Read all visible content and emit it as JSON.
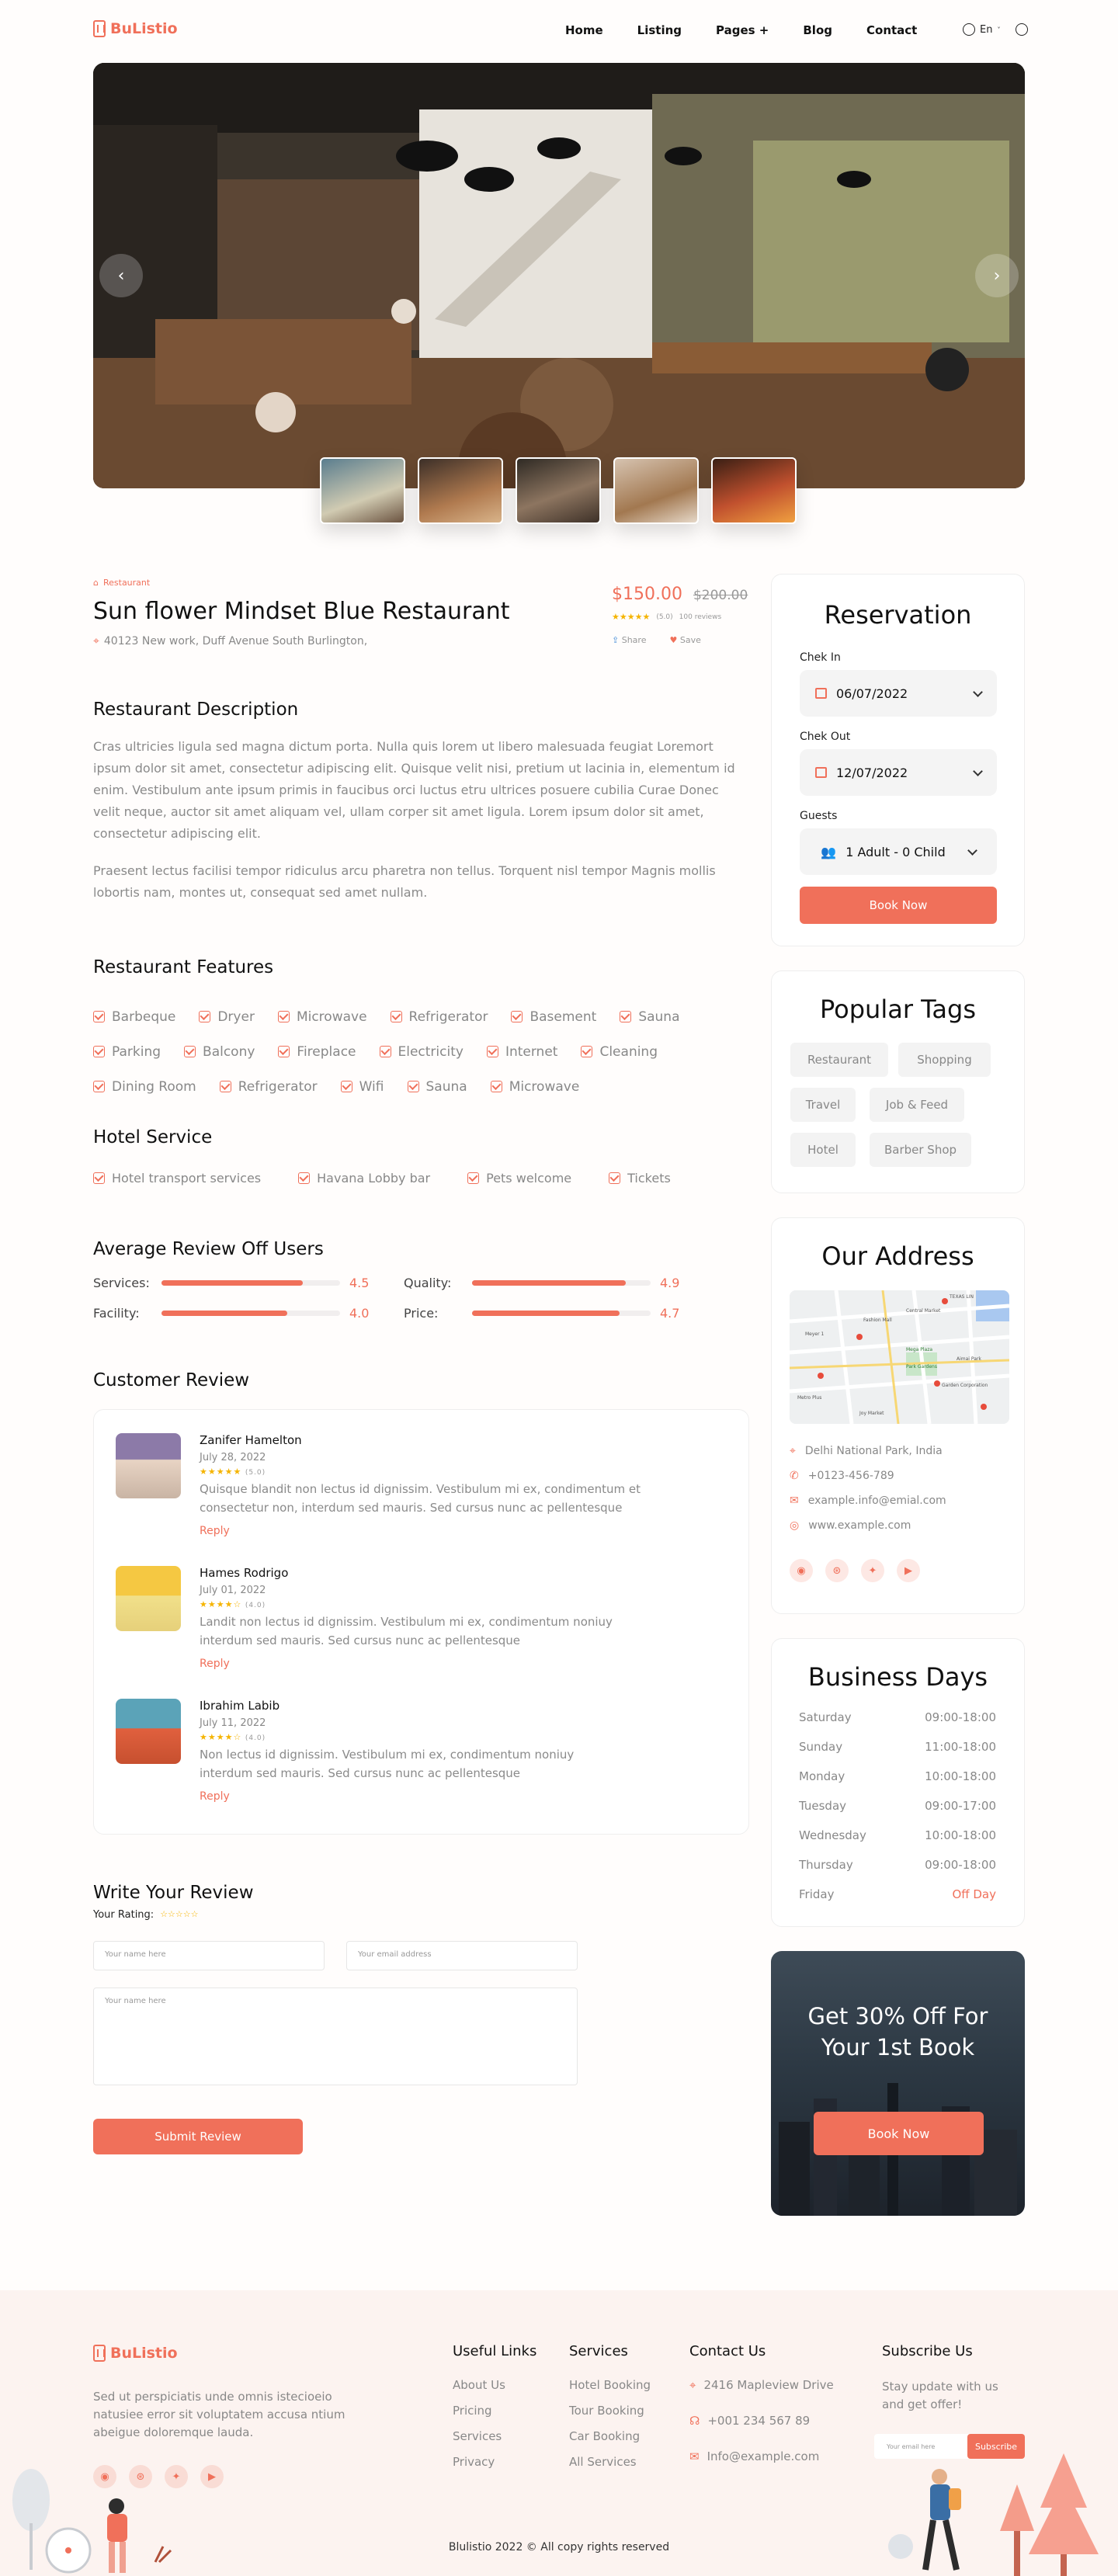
{
  "header": {
    "logo": "BuListio",
    "nav": [
      "Home",
      "Listing",
      "Pages +",
      "Blog",
      "Contact"
    ],
    "lang": "En"
  },
  "hero": {
    "prev_icon": "chevron-left-icon",
    "next_icon": "chevron-right-icon"
  },
  "listing": {
    "category": "Restaurant",
    "title": "Sun flower Mindset Blue Restaurant",
    "address": "40123 New work,  Duff Avenue South Burlington,",
    "price": "$150.00",
    "old_price": "$200.00",
    "rating": "(5.0)",
    "reviews": "100 reviews",
    "share": "Share",
    "save": "Save"
  },
  "description": {
    "title": "Restaurant Description",
    "p1": "Cras ultricies ligula sed magna dictum porta. Nulla quis lorem ut libero malesuada feugiat Loremort ipsum dolor sit amet, consectetur adipiscing elit. Quisque velit nisi, pretium ut lacinia in, elementum id enim. Vestibulum ante ipsum primis in faucibus orci luctus etru ultrices posuere cubilia Curae Donec velit neque, auctor sit amet aliquam vel, ullam corper sit amet ligula. Lorem ipsum dolor sit amet, consectetur adipiscing elit.",
    "p2": "Praesent lectus facilisi tempor ridiculus arcu pharetra non tellus. Torquent nisl tempor Magnis mollis lobortis nam, montes ut, consequat sed amet nullam."
  },
  "features": {
    "title": "Restaurant Features",
    "rows": [
      [
        "Barbeque",
        "Dryer",
        "Microwave",
        "Refrigerator",
        "Basement",
        "Sauna"
      ],
      [
        "Parking",
        "Balcony",
        "Fireplace",
        "Electricity",
        "Internet",
        "Cleaning"
      ],
      [
        "Dining Room",
        "Refrigerator",
        "Wifi",
        "Sauna",
        "Microwave"
      ]
    ]
  },
  "hotel_service": {
    "title": "Hotel Service",
    "items": [
      "Hotel transport services",
      "Havana Lobby bar",
      "Pets welcome",
      "Tickets"
    ]
  },
  "avg_review": {
    "title": "Average Review Off Users",
    "items": [
      {
        "label": "Services:",
        "value": "4.5",
        "score": 4.5
      },
      {
        "label": "Quality:",
        "value": "4.9",
        "score": 4.9
      },
      {
        "label": "Facility:",
        "value": "4.0",
        "score": 4.0
      },
      {
        "label": "Price:",
        "value": "4.7",
        "score": 4.7
      }
    ]
  },
  "customer_review": {
    "title": "Customer Review",
    "reviews": [
      {
        "name": "Zanifer Hamelton",
        "date": "July 28,  2022",
        "stars": "★★★★★",
        "score": "(5.0)",
        "text": "Quisque blandit non lectus id dignissim. Vestibulum mi ex, condimentum et consectetur non, interdum sed mauris. Sed cursus nunc ac pellentesque",
        "reply": "Reply"
      },
      {
        "name": "Hames Rodrigo",
        "date": "July 01,  2022",
        "stars": "★★★★☆",
        "score": "(4.0)",
        "text": "Landit non lectus id dignissim. Vestibulum mi ex, condimentum  noniuy interdum sed mauris. Sed cursus nunc ac pellentesque",
        "reply": "Reply"
      },
      {
        "name": "Ibrahim Labib",
        "date": "July 11,  2022",
        "stars": "★★★★☆",
        "score": "(4.0)",
        "text": "Non lectus id dignissim. Vestibulum mi ex, condimentum  noniuy interdum sed mauris. Sed cursus nunc ac pellentesque",
        "reply": "Reply"
      }
    ]
  },
  "write_review": {
    "title": "Write Your Review",
    "rating_label": "Your Rating:",
    "rating_stars": "☆☆☆☆☆",
    "name_placeholder": "Your name here",
    "email_placeholder": "Your email address",
    "message_placeholder": "Your name here",
    "submit": "Submit Review"
  },
  "reservation": {
    "title": "Reservation",
    "checkin_label": "Chek In",
    "checkin": "06/07/2022",
    "checkout_label": "Chek Out",
    "checkout": "12/07/2022",
    "guests_label": "Guests",
    "guests": "1 Adult - 0 Child",
    "book": "Book Now"
  },
  "tags": {
    "title": "Popular Tags",
    "items": [
      "Restaurant",
      "Shopping",
      "Travel",
      "Job & Feed",
      "Hotel",
      "Barber Shop"
    ]
  },
  "address": {
    "title": "Our Address",
    "location": "Delhi National Park, India",
    "phone": "+0123-456-789",
    "email": "example.info@emial.com",
    "web": "www.example.com",
    "map_labels": [
      "TEXAS LIN",
      "Central Market",
      "Fashion Mall",
      "Meyer 1",
      "Mega Plaza",
      "Aimai Park",
      "Park Gardens",
      "Garden Corporation",
      "Metro Plus",
      "Joy Market"
    ]
  },
  "business_days": {
    "title": "Business Days",
    "days": [
      {
        "day": "Saturday",
        "hours": "09:00-18:00"
      },
      {
        "day": "Sunday",
        "hours": "11:00-18:00"
      },
      {
        "day": "Monday",
        "hours": "10:00-18:00"
      },
      {
        "day": "Tuesday",
        "hours": "09:00-17:00"
      },
      {
        "day": "Wednesday",
        "hours": "10:00-18:00"
      },
      {
        "day": "Thursday",
        "hours": "09:00-18:00"
      },
      {
        "day": "Friday",
        "hours": "Off Day"
      }
    ]
  },
  "promo": {
    "title": "Get 30% Off For Your 1st Book",
    "button": "Book Now"
  },
  "footer": {
    "logo": "BuListio",
    "about": "Sed ut perspiciatis unde omnis istecioeio natusiee error sit voluptatem accusa ntium abeigue doloremque lauda.",
    "useful_title": "Useful Links",
    "useful": [
      "About Us",
      "Pricing",
      "Services",
      "Privacy"
    ],
    "services_title": "Services",
    "services": [
      "Hotel Booking",
      "Tour Booking",
      "Car Booking",
      "All Services"
    ],
    "contact_title": "Contact Us",
    "contact_address": "2416 Mapleview Drive",
    "contact_phone": "+001 234 567 89",
    "contact_email": "Info@example.com",
    "subscribe_title": "Subscribe Us",
    "subscribe_text": "Stay update with us and get offer!",
    "subscribe_placeholder": "Your email here",
    "subscribe_button": "Subscribe",
    "copyright": "Blulistio 2022 © All copy rights reserved"
  }
}
